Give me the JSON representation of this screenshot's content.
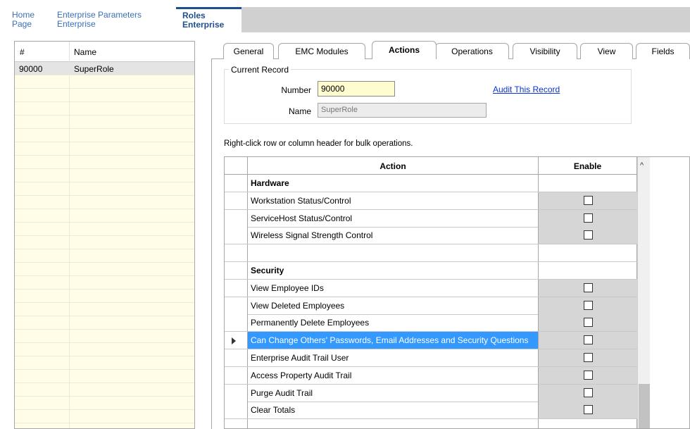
{
  "topnav": {
    "home": [
      "Home",
      "Page"
    ],
    "enterprise_parameters": [
      "Enterprise Parameters",
      "Enterprise"
    ],
    "roles": [
      "Roles",
      "Enterprise"
    ]
  },
  "list": {
    "headers": {
      "num": "#",
      "name": "Name"
    },
    "rows": [
      {
        "num": "90000",
        "name": "SuperRole"
      }
    ]
  },
  "tabs": [
    "General",
    "EMC Modules",
    "Actions",
    "Operations",
    "Visibility",
    "View",
    "Fields"
  ],
  "active_tab": "Actions",
  "record": {
    "legend": "Current Record",
    "number_label": "Number",
    "number_value": "90000",
    "name_label": "Name",
    "name_value": "SuperRole",
    "audit_link": "Audit This Record"
  },
  "hint": "Right-click row or column header for bulk operations.",
  "grid": {
    "headers": {
      "action": "Action",
      "enable": "Enable"
    },
    "rows": [
      {
        "type": "section",
        "label": "Hardware"
      },
      {
        "type": "item",
        "label": "Workstation Status/Control"
      },
      {
        "type": "item",
        "label": "ServiceHost Status/Control"
      },
      {
        "type": "item",
        "label": "Wireless Signal Strength Control"
      },
      {
        "type": "empty",
        "label": ""
      },
      {
        "type": "section",
        "label": "Security"
      },
      {
        "type": "item",
        "label": "View Employee IDs"
      },
      {
        "type": "item",
        "label": "View Deleted Employees"
      },
      {
        "type": "item",
        "label": "Permanently Delete Employees"
      },
      {
        "type": "item",
        "label": "Can Change Others' Passwords, Email Addresses and Security Questions",
        "selected": true
      },
      {
        "type": "item",
        "label": "Enterprise Audit Trail User"
      },
      {
        "type": "item",
        "label": "Access Property Audit Trail"
      },
      {
        "type": "item",
        "label": "Purge Audit Trail"
      },
      {
        "type": "item",
        "label": "Clear Totals"
      },
      {
        "type": "empty",
        "label": ""
      }
    ]
  },
  "colors": {
    "selection": "#3399ff",
    "link": "#0b33d6",
    "number_bg": "#fffdd0",
    "list_bg": "#fffde8"
  }
}
